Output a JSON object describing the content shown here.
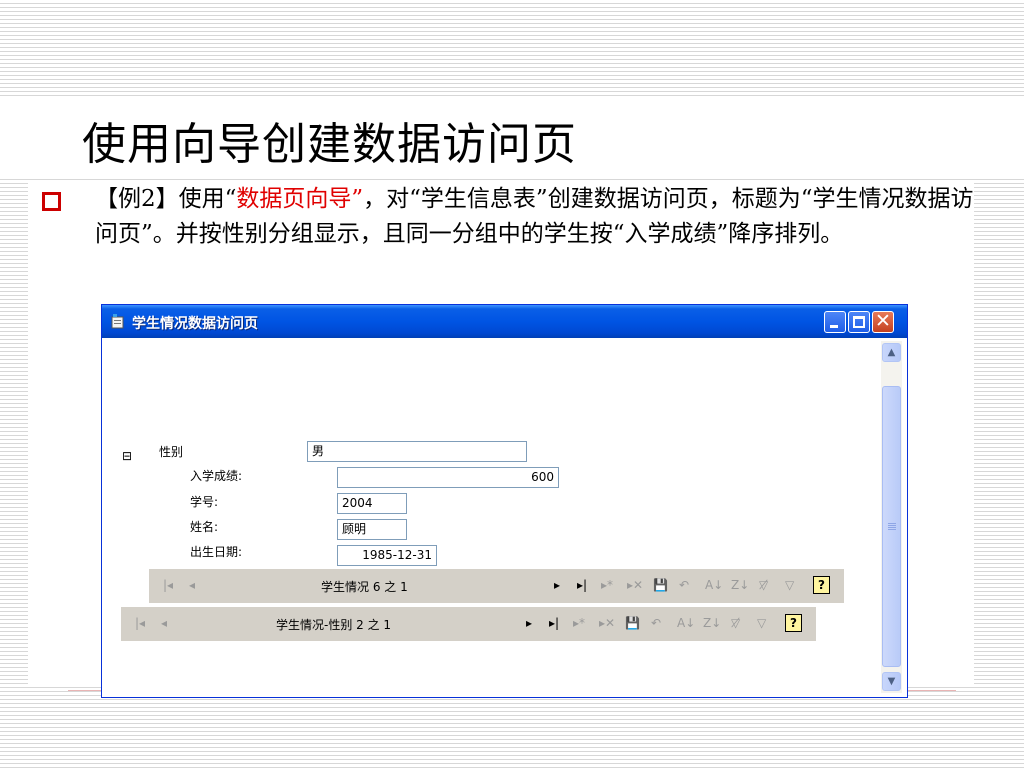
{
  "slide": {
    "title": "使用向导创建数据访问页",
    "text_prefix": "【例2】使用“",
    "text_highlight": "数据页向导”",
    "text_rest": "，对“学生信息表”创建数据访问页，标题为“学生情况数据访问页”。并按性别分组显示，且同一分组中的学生按“入学成绩”降序排列。"
  },
  "window": {
    "title": "学生情况数据访问页",
    "buttons": {
      "minimize": "_",
      "maximize": "□",
      "close": "✕"
    },
    "collapse_symbol": "⊟",
    "group_field": {
      "label": "性别",
      "value": "男"
    },
    "fields": [
      {
        "label": "入学成绩:",
        "value": "600"
      },
      {
        "label": "学号:",
        "value": "2004"
      },
      {
        "label": "姓名:",
        "value": "顾明"
      },
      {
        "label": "出生日期:",
        "value": "1985-12-31"
      }
    ],
    "inner_nav": {
      "status": "学生情况 6 之 1"
    },
    "outer_nav": {
      "status": "学生情况-性别 2 之 1"
    },
    "nav_icons": {
      "first": "|◂",
      "prev": "◂",
      "next": "▸",
      "last": "▸|",
      "new": "▸*",
      "delete": "▸✕",
      "save": "💾",
      "undo": "↶",
      "sort_asc": "A↓",
      "sort_desc": "Z↓",
      "filter_toggle": "▽̸",
      "filter": "▽",
      "help": "?"
    },
    "icons": [
      "app-icon",
      "collapse-icon",
      "first-record-icon",
      "prev-record-icon",
      "next-record-icon",
      "last-record-icon",
      "new-record-icon",
      "delete-record-icon",
      "save-record-icon",
      "undo-icon",
      "sort-ascending-icon",
      "sort-descending-icon",
      "filter-toggle-icon",
      "filter-icon",
      "help-icon"
    ]
  },
  "colors": {
    "highlight": "#e00000",
    "bullet": "#cc0000",
    "titlebar": "#0054e3",
    "nav_background": "#d4d0c8"
  }
}
